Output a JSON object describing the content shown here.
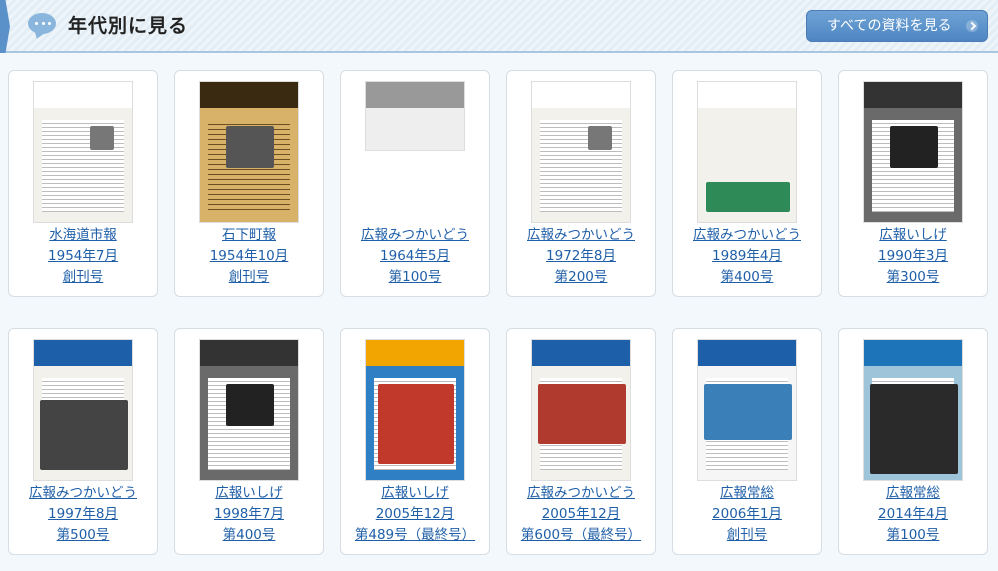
{
  "header": {
    "title": "年代別に見る",
    "all_button_label": "すべての資料を見る"
  },
  "items": [
    {
      "name": "水海道市報",
      "date": "1954年7月",
      "issue": "創刊号",
      "thumb_style": "newspaper"
    },
    {
      "name": "石下町報",
      "date": "1954年10月",
      "issue": "創刊号",
      "thumb_style": "aged"
    },
    {
      "name": "広報みつかいどう",
      "date": "1964年5月",
      "issue": "第100号",
      "thumb_style": "landscape"
    },
    {
      "name": "広報みつかいどう",
      "date": "1972年8月",
      "issue": "第200号",
      "thumb_style": "newspaper"
    },
    {
      "name": "広報みつかいどう",
      "date": "1989年4月",
      "issue": "第400号",
      "thumb_style": "green"
    },
    {
      "name": "広報いしげ",
      "date": "1990年3月",
      "issue": "第300号",
      "thumb_style": "photo"
    },
    {
      "name": "広報みつかいどう",
      "date": "1997年8月",
      "issue": "第500号",
      "thumb_style": "blue"
    },
    {
      "name": "広報いしげ",
      "date": "1998年7月",
      "issue": "第400号",
      "thumb_style": "photo"
    },
    {
      "name": "広報いしげ",
      "date": "2005年12月",
      "issue": "第489号（最終号）",
      "thumb_style": "festival"
    },
    {
      "name": "広報みつかいどう",
      "date": "2005年12月",
      "issue": "第600号（最終号）",
      "thumb_style": "parade"
    },
    {
      "name": "広報常総",
      "date": "2006年1月",
      "issue": "創刊号",
      "thumb_style": "river"
    },
    {
      "name": "広報常総",
      "date": "2014年4月",
      "issue": "第100号",
      "thumb_style": "people"
    }
  ]
}
